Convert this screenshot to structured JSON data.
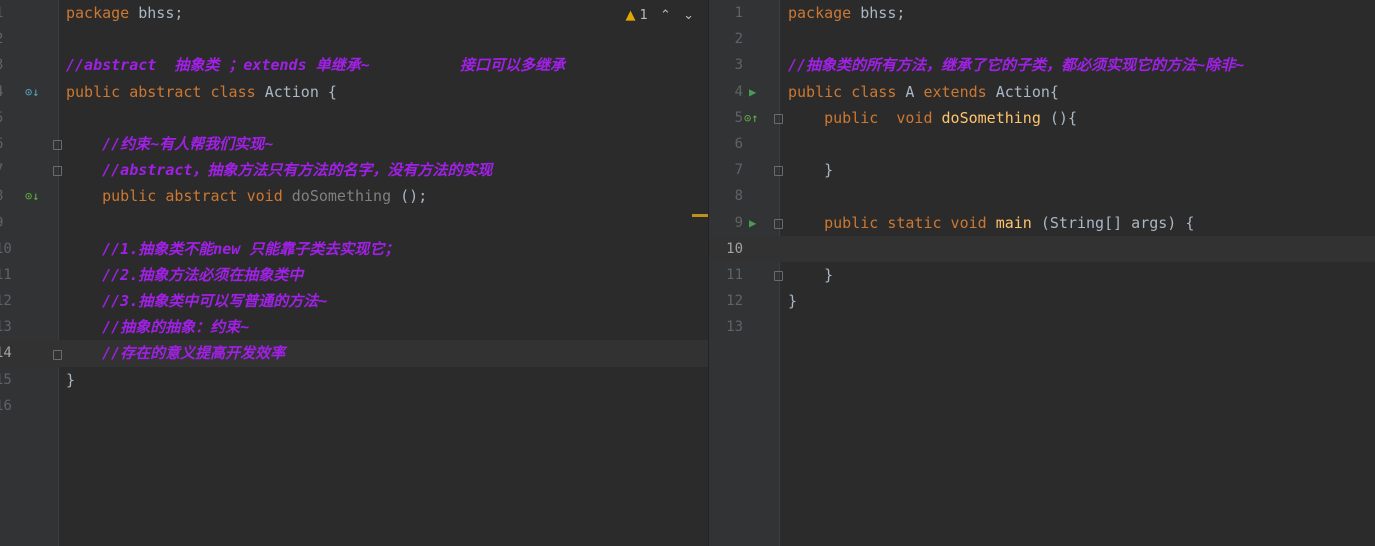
{
  "left_editor": {
    "inspection": {
      "warning_count": "1",
      "up": "⌃",
      "down": "⌄"
    },
    "lines": [
      {
        "n": "1",
        "parts": [
          [
            "kw",
            "package"
          ],
          [
            "",
            "bhss;"
          ]
        ]
      },
      {
        "n": "2",
        "parts": []
      },
      {
        "n": "3",
        "parts": [
          [
            "cm",
            "//abstract  抽象类 ；extends 单继承~          接口可以多继承"
          ]
        ]
      },
      {
        "n": "4",
        "parts": [
          [
            "kw",
            "public abstract class"
          ],
          [
            "",
            "Action {"
          ]
        ]
      },
      {
        "n": "5",
        "parts": []
      },
      {
        "n": "6",
        "parts": [
          [
            "cm",
            "    //约束~有人帮我们实现~"
          ]
        ]
      },
      {
        "n": "7",
        "parts": [
          [
            "cm",
            "    //abstract，抽象方法只有方法的名字，没有方法的实现"
          ]
        ]
      },
      {
        "n": "8",
        "parts": [
          [
            "kw",
            "    public abstract void"
          ],
          [
            "gr",
            "doSomething"
          ],
          [
            "",
            "();"
          ]
        ]
      },
      {
        "n": "9",
        "parts": []
      },
      {
        "n": "10",
        "parts": [
          [
            "cm",
            "    //1.抽象类不能new 只能靠子类去实现它；"
          ]
        ]
      },
      {
        "n": "11",
        "parts": [
          [
            "cm",
            "    //2.抽象方法必须在抽象类中"
          ]
        ]
      },
      {
        "n": "12",
        "parts": [
          [
            "cm",
            "    //3.抽象类中可以写普通的方法~"
          ]
        ]
      },
      {
        "n": "13",
        "parts": [
          [
            "cm",
            "    //抽象的抽象：约束~"
          ]
        ]
      },
      {
        "n": "14",
        "parts": [
          [
            "cm",
            "    //存在的意义提高开发效率"
          ]
        ],
        "current": true
      },
      {
        "n": "15",
        "parts": [
          [
            "",
            "}"
          ]
        ]
      },
      {
        "n": "16",
        "parts": []
      }
    ]
  },
  "right_editor": {
    "lines": [
      {
        "n": "1",
        "parts": [
          [
            "kw",
            "package"
          ],
          [
            "",
            "bhss;"
          ]
        ]
      },
      {
        "n": "2",
        "parts": []
      },
      {
        "n": "3",
        "parts": [
          [
            "cm",
            "//抽象类的所有方法，继承了它的子类，都必须实现它的方法~除非~"
          ]
        ]
      },
      {
        "n": "4",
        "parts": [
          [
            "kw",
            "public class"
          ],
          [
            "",
            "A"
          ],
          [
            "kw",
            "extends"
          ],
          [
            "",
            "Action{"
          ]
        ]
      },
      {
        "n": "5",
        "parts": [
          [
            "kw",
            "    public  void"
          ],
          [
            "fn",
            "doSomething"
          ],
          [
            "",
            "(){"
          ]
        ]
      },
      {
        "n": "6",
        "parts": []
      },
      {
        "n": "7",
        "parts": [
          [
            "",
            "    }"
          ]
        ]
      },
      {
        "n": "8",
        "parts": []
      },
      {
        "n": "9",
        "parts": [
          [
            "kw",
            "    public static void"
          ],
          [
            "fn",
            "main"
          ],
          [
            "",
            "(String[] args) {"
          ]
        ]
      },
      {
        "n": "10",
        "parts": [],
        "current": true
      },
      {
        "n": "11",
        "parts": [
          [
            "",
            "    }"
          ]
        ]
      },
      {
        "n": "12",
        "parts": [
          [
            "",
            "}"
          ]
        ]
      },
      {
        "n": "13",
        "parts": []
      }
    ]
  },
  "colors": {
    "keyword": "#cc7832",
    "comment": "#a020e6",
    "function": "#ffc66d",
    "text": "#a9b7c6"
  }
}
